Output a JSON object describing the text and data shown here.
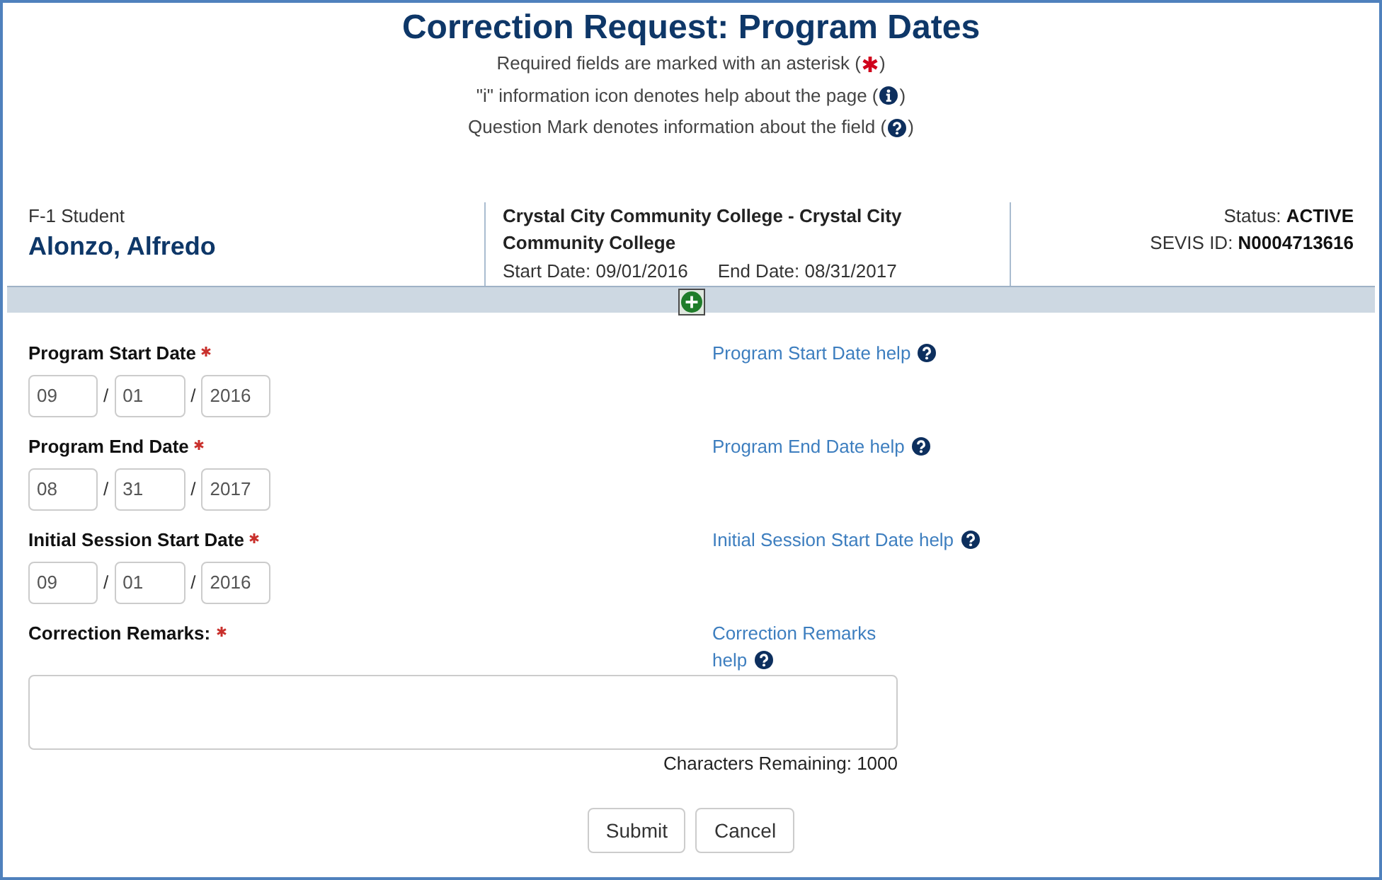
{
  "header": {
    "title": "Correction Request: Program Dates",
    "notes": [
      {
        "kind": "asterisk",
        "before": "Required fields are marked with an asterisk (",
        "after": ")"
      },
      {
        "kind": "info",
        "before": "\"i\" information icon denotes help about the page (",
        "after": ")"
      },
      {
        "kind": "question",
        "before": "Question Mark denotes information about the field (",
        "after": ")"
      }
    ]
  },
  "student": {
    "category": "F-1 Student",
    "name": "Alonzo, Alfredo"
  },
  "program": {
    "school": "Crystal City Community College - Crystal City Community College",
    "start_date": "Start Date: 09/01/2016",
    "end_date": "End Date: 08/31/2017"
  },
  "record": {
    "status": "Status: **ACTIVE**",
    "sevis_id": "SEVIS ID: **N0004713616**"
  },
  "details_toggle": {
    "expanded": false
  },
  "fields": [
    {
      "kind": "date",
      "label": "Program Start Date",
      "required": true,
      "parts": [
        "09",
        "01",
        "2016"
      ],
      "separators": [
        "/",
        "/"
      ],
      "help": "Program Start Date help"
    },
    {
      "kind": "date",
      "label": "Program End Date",
      "required": true,
      "parts": [
        "08",
        "31",
        "2017"
      ],
      "separators": [
        "/",
        "/"
      ],
      "help": "Program End Date help"
    },
    {
      "kind": "date",
      "label": "Initial Session Start Date",
      "required": true,
      "parts": [
        "09",
        "01",
        "2016"
      ],
      "separators": [
        "/",
        "/"
      ],
      "help": "Initial Session Start Date help"
    },
    {
      "kind": "remarks",
      "label": "Correction Remarks:",
      "required": true,
      "help": "Correction Remarks help",
      "counter": "Characters Remaining: 1000"
    }
  ],
  "buttons": [
    "Submit",
    "Cancel"
  ]
}
